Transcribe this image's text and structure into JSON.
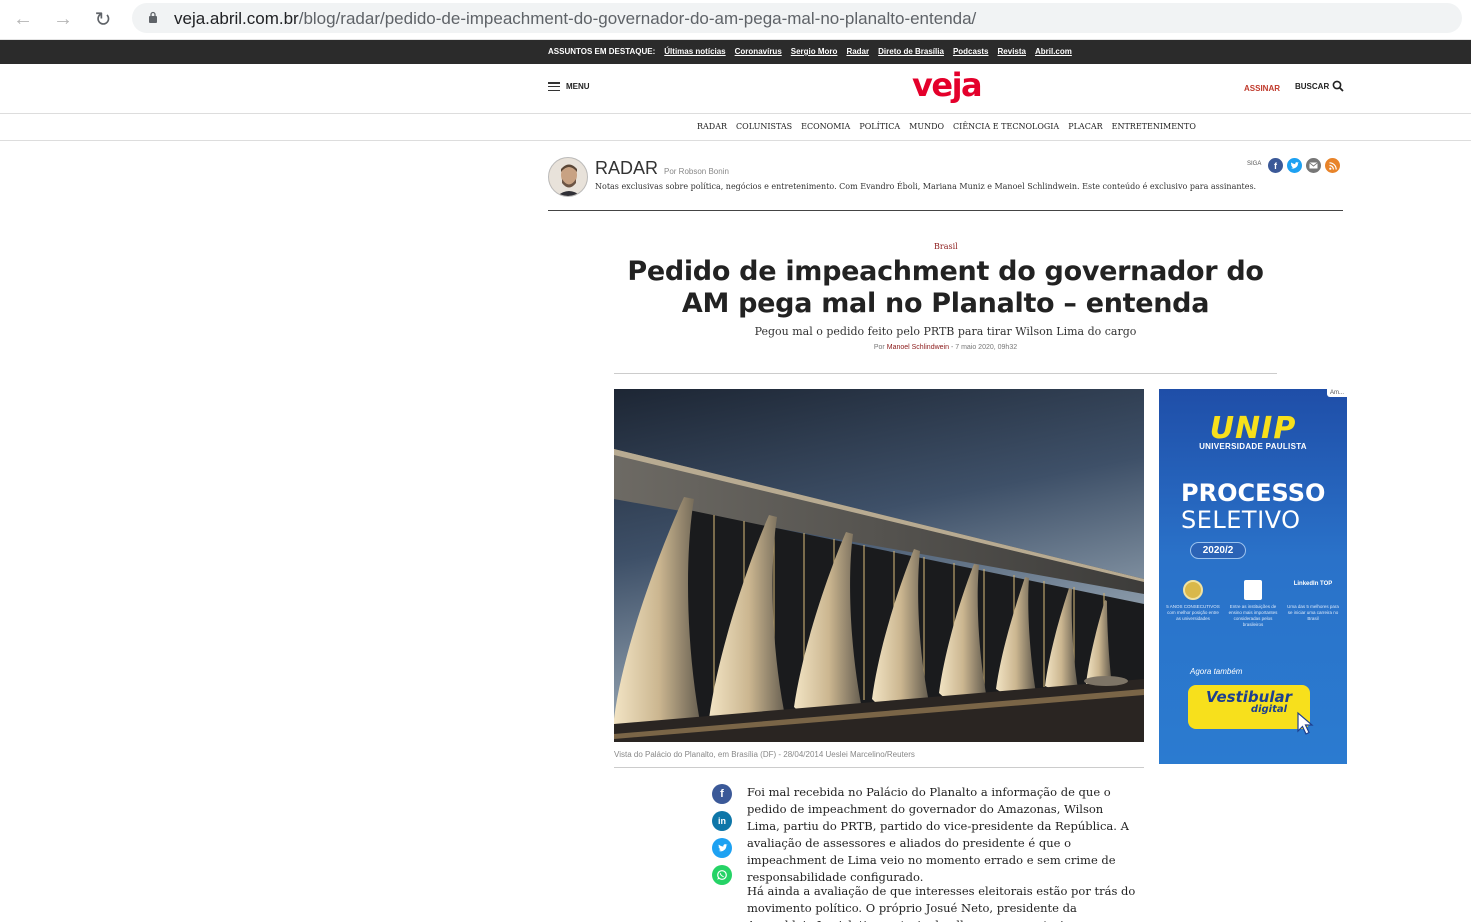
{
  "browser": {
    "url_host": "veja.abril.com.br",
    "url_path": "/blog/radar/pedido-de-impeachment-do-governador-do-am-pega-mal-no-planalto-entenda/"
  },
  "topics": {
    "label": "ASSUNTOS EM DESTAQUE:",
    "items": [
      "Últimas notícias",
      "Coronavírus",
      "Sergio Moro",
      "Radar",
      "Direto de Brasília",
      "Podcasts",
      "Revista",
      "Abril.com"
    ]
  },
  "header": {
    "menu_label": "MENU",
    "logo": "veja",
    "subscribe_label": "ASSINAR",
    "search_label": "BUSCAR",
    "brand_color": "#e4002b"
  },
  "sections": [
    "RADAR",
    "COLUNISTAS",
    "ECONOMIA",
    "POLÍTICA",
    "MUNDO",
    "CIÊNCIA E TECNOLOGIA",
    "PLACAR",
    "ENTRETENIMENTO"
  ],
  "blog": {
    "title": "RADAR",
    "author": "Por Robson Bonin",
    "description": "Notas exclusivas sobre política, negócios e entretenimento. Com Evandro Éboli, Mariana Muniz e Manoel Schlindwein. Este conteúdo é exclusivo para assinantes.",
    "follow_label": "SIGA",
    "follow_icons": [
      "facebook-icon",
      "twitter-icon",
      "email-icon",
      "rss-icon"
    ]
  },
  "article": {
    "category": "Brasil",
    "headline": "Pedido de impeachment do governador do AM pega mal no Planalto – entenda",
    "subheadline": "Pegou mal o pedido feito pelo PRTB para tirar Wilson Lima do cargo",
    "byline_prefix": "Por",
    "author": "Manoel Schlindwein",
    "date": "- 7 maio 2020, 09h32",
    "caption": "Vista do Palácio do Planalto, em Brasília (DF) - 28/04/2014  Ueslei Marcelino/Reuters",
    "share_icons": [
      "facebook-icon",
      "linkedin-icon",
      "twitter-icon",
      "whatsapp-icon"
    ],
    "paragraphs": [
      "Foi mal recebida no Palácio do Planalto a informação de que o pedido de impeachment do governador do Amazonas, Wilson Lima, partiu do PRTB, partido do vice-presidente da República. A avaliação de assessores e aliados do presidente é que o impeachment de Lima veio no momento errado e sem crime de responsabilidade configurado.",
      "Há ainda a avaliação de que interesses eleitorais estão por trás do movimento político. O próprio Josué Neto, presidente da Assembleia Legislativa, estaria de olho no cargo e teria conversas com aliados de Bolsonaro."
    ]
  },
  "ad": {
    "tag": "Am...",
    "brand": "UNIP",
    "brand_sub": "UNIVERSIDADE PAULISTA",
    "line1": "PROCESSO",
    "line2": "SELETIVO",
    "year": "2020/2",
    "awards": [
      "5 ANOS CONSECUTIVOS com melhor posição entre as universidades",
      "Entre as instituições de ensino mais importantes consideradas pelos brasileiros",
      "Uma das 5 melhores para se iniciar uma carreira no Brasil"
    ],
    "award_top_labels": [
      "",
      "",
      "LinkedIn TOP"
    ],
    "also_label": "Agora também",
    "cta_line1": "Vestibular",
    "cta_line2": "digital"
  }
}
